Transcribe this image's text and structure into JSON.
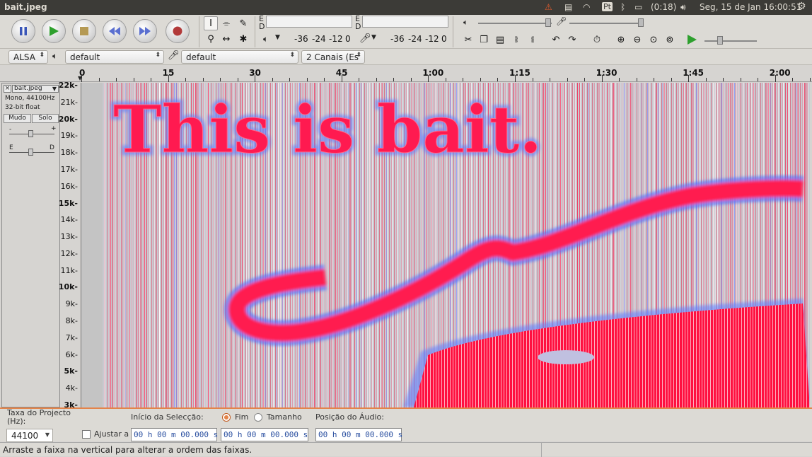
{
  "window": {
    "title": "bait.jpeg"
  },
  "tray": {
    "battery": "(0:18)",
    "datetime": "Seg, 15 de Jan 16:00:51",
    "keyboard": "Pt"
  },
  "meters": {
    "rec_labels": [
      "E",
      "D"
    ],
    "play_labels": [
      "E",
      "D"
    ],
    "rec_scale": [
      "-36",
      "-24",
      "-12",
      "0"
    ],
    "play_scale": [
      "-36",
      "-24",
      "-12",
      "0"
    ]
  },
  "devices": {
    "host": "ALSA",
    "playback_device": "default",
    "record_device": "default",
    "channels": "2 Canais (Es"
  },
  "ruler": {
    "labels": [
      "0",
      "15",
      "30",
      "45",
      "1:00",
      "1:15",
      "1:30",
      "1:45",
      "2:00"
    ]
  },
  "track": {
    "name": "bait.jpeg",
    "info_rate": "Mono, 44100Hz",
    "info_format": "32-bit float",
    "mute_label": "Mudo",
    "solo_label": "Solo",
    "gain_minus": "-",
    "gain_plus": "+",
    "pan_left": "E",
    "pan_right": "D"
  },
  "freq_axis": [
    "22k",
    "21k",
    "20k",
    "19k",
    "18k",
    "17k",
    "16k",
    "15k",
    "14k",
    "13k",
    "12k",
    "11k",
    "10k",
    "9k",
    "8k",
    "7k",
    "6k",
    "5k",
    "4k",
    "3k"
  ],
  "spectrogram": {
    "hidden_text": "This is bait."
  },
  "selection": {
    "project_rate_label": "Taxa do Projecto (Hz):",
    "project_rate_value": "44100",
    "snap_label": "Ajustar a",
    "start_label": "Início da Selecção:",
    "end_label": "Fim",
    "length_label": "Tamanho",
    "audio_pos_label": "Posição do Áudio:",
    "start_time": "00 h 00 m 00.000 s",
    "end_time": "00 h 00 m 00.000 s",
    "audio_time": "00 h 00 m 00.000 s"
  },
  "status": {
    "message": "Arraste a faixa na vertical para alterar a ordem das faixas."
  },
  "colors": {
    "accent": "#e4844a",
    "spectro_hot": "#ff1040",
    "spectro_cool": "#4060ff",
    "panel": "#3c3b37"
  }
}
